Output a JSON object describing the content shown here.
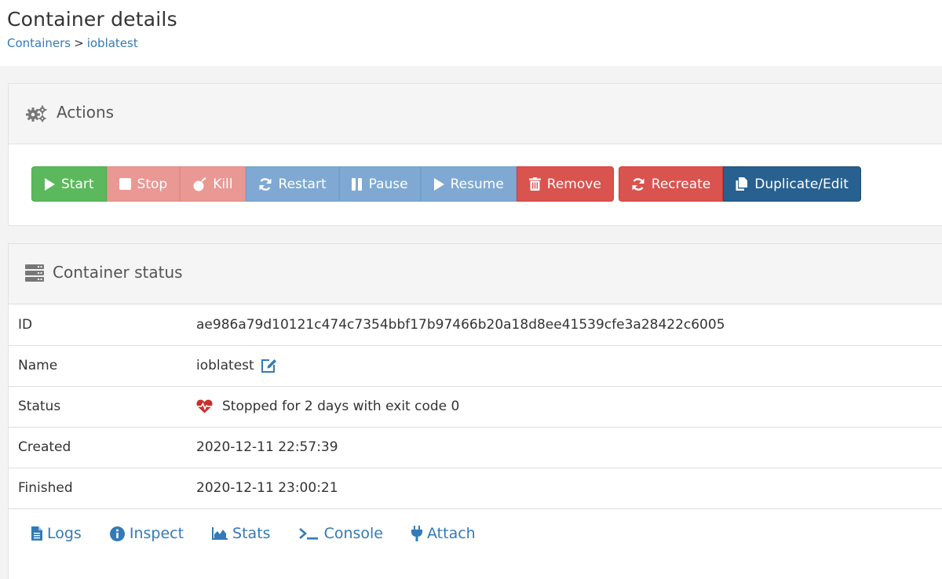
{
  "header": {
    "title": "Container details",
    "breadcrumb": {
      "parent": "Containers",
      "separator": ">",
      "current": "ioblatest"
    }
  },
  "actions": {
    "title": "Actions",
    "buttons": {
      "start": "Start",
      "stop": "Stop",
      "kill": "Kill",
      "restart": "Restart",
      "pause": "Pause",
      "resume": "Resume",
      "remove": "Remove",
      "recreate": "Recreate",
      "duplicate": "Duplicate/Edit"
    }
  },
  "status": {
    "title": "Container status",
    "rows": [
      {
        "key": "ID",
        "value": "ae986a79d10121c474c7354bbf17b97466b20a18d8ee41539cfe3a28422c6005"
      },
      {
        "key": "Name",
        "value": "ioblatest"
      },
      {
        "key": "Status",
        "value": "Stopped for 2 days with exit code 0"
      },
      {
        "key": "Created",
        "value": "2020-12-11 22:57:39"
      },
      {
        "key": "Finished",
        "value": "2020-12-11 23:00:21"
      }
    ],
    "links": {
      "logs": "Logs",
      "inspect": "Inspect",
      "stats": "Stats",
      "console": "Console",
      "attach": "Attach"
    }
  },
  "colors": {
    "success": "#5cb85c",
    "danger": "#d9534f",
    "primary": "#337ab7",
    "primary_dark": "#286090",
    "status_heart": "#c9302c"
  },
  "icons": [
    "cogs-icon",
    "server-icon",
    "play-icon",
    "stop-icon",
    "bomb-icon",
    "refresh-icon",
    "pause-icon",
    "trash-icon",
    "copy-icon",
    "edit-icon",
    "heartbeat-icon",
    "file-icon",
    "info-icon",
    "chart-icon",
    "terminal-icon",
    "plug-icon"
  ]
}
